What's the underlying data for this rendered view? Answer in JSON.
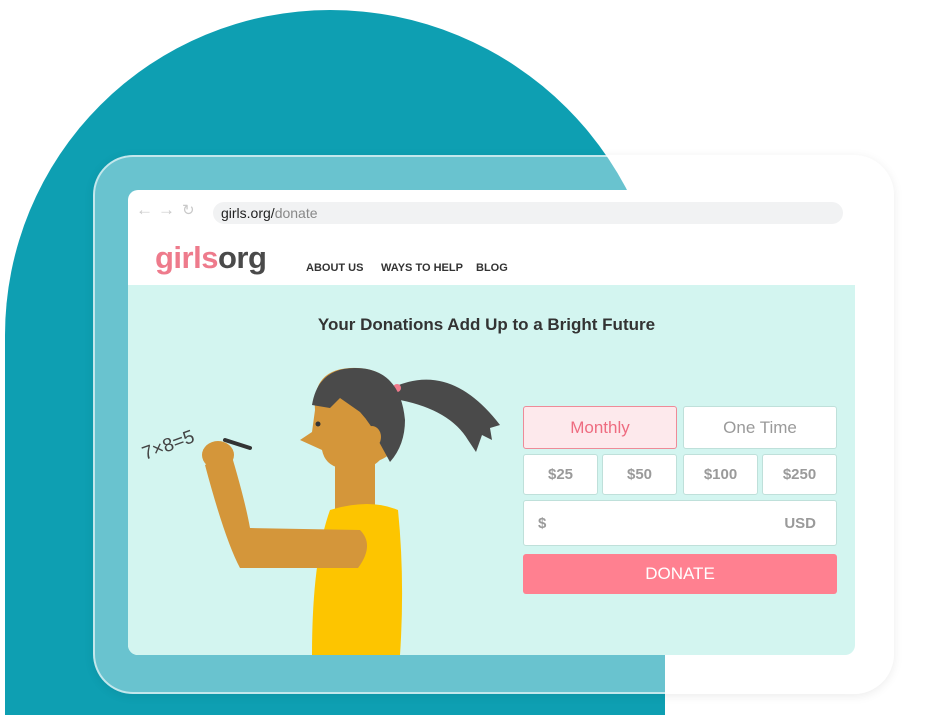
{
  "browser": {
    "back_icon": "arrow-left-icon",
    "forward_icon": "arrow-right-icon",
    "reload_icon": "reload-icon",
    "url_host": "girls.org/",
    "url_path": "donate"
  },
  "site": {
    "logo_part1": "girls",
    "logo_part2": "org",
    "nav": [
      "ABOUT US",
      "WAYS TO HELP",
      "BLOG"
    ]
  },
  "main": {
    "title": "Your Donations Add Up to a Bright Future",
    "illustration_text": "7×8=5",
    "form": {
      "frequency": [
        {
          "label": "Monthly",
          "selected": true
        },
        {
          "label": "One Time",
          "selected": false
        }
      ],
      "amounts": [
        "$25",
        "$50",
        "$100",
        "$250"
      ],
      "currency_symbol": "$",
      "currency_code": "USD",
      "donate_label": "DONATE"
    }
  },
  "colors": {
    "brand_pink": "#ee7b8c",
    "donate_button": "#ff8090",
    "teal_blob": "#0e9fb2",
    "content_bg": "#d3f5f0"
  }
}
